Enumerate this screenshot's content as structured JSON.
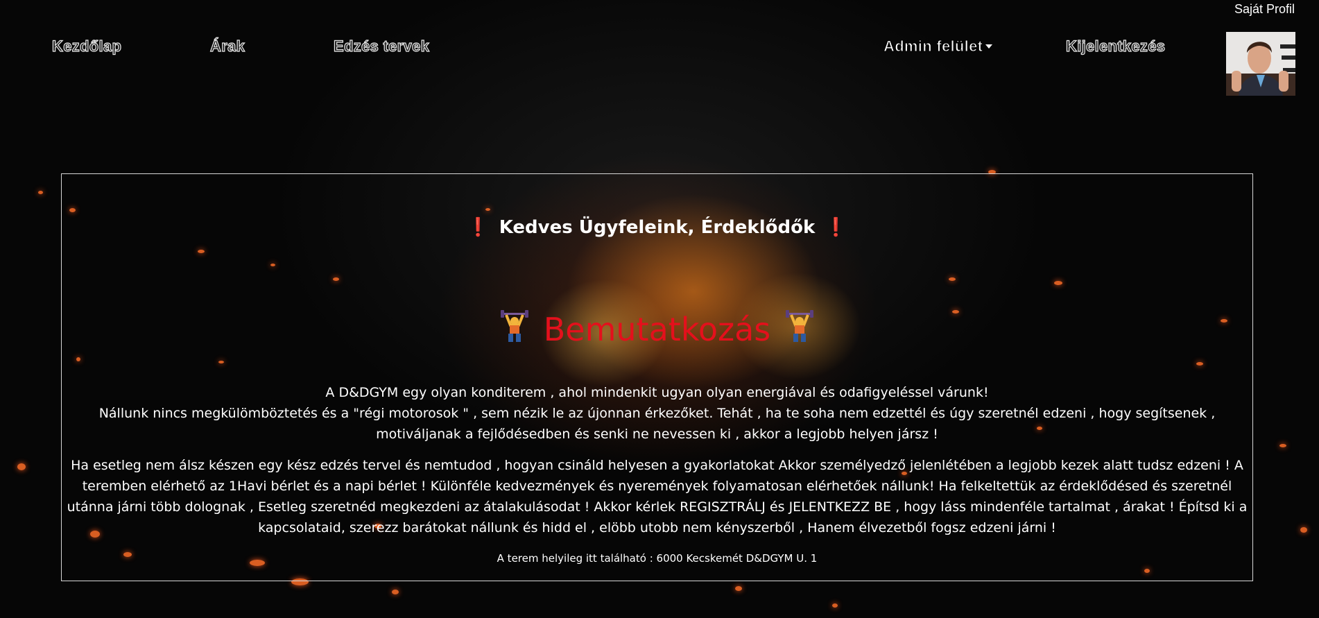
{
  "header": {
    "profile_link": "Saját Profil",
    "nav": {
      "home": "Kezdőlap",
      "prices": "Árak",
      "plans": "Edzés tervek",
      "admin": "Admin felület",
      "logout": "Kijelentkezés"
    }
  },
  "content": {
    "greeting": "Kedves Ügyfeleink, Érdeklődők",
    "greeting_icon": "exclamation-mark-icon",
    "intro_title": "Bemutatkozás",
    "intro_icon": "weightlifter-icon",
    "paragraph1_line1": "A D&DGYM egy olyan konditerem , ahol mindenkit ugyan olyan energiával és odafigyeléssel várunk!",
    "paragraph1_line2": "Nállunk nincs megkülömböztetés és a \"régi motorosok \" , sem nézik le az újonnan érkezőket. Tehát , ha te soha nem edzettél és úgy szeretnél edzeni , hogy segítsenek , motiváljanak a fejlődésedben és senki ne nevessen ki , akkor a legjobb helyen jársz !",
    "paragraph2": "Ha esetleg nem álsz készen egy kész edzés tervel és nemtudod , hogyan csináld helyesen a gyakorlatokat Akkor személyedző jelenlétében a legjobb kezek alatt tudsz edzeni ! A teremben elérhető az 1Havi bérlet és a napi bérlet ! Különféle kedvezmények és nyeremények folyamatosan elérhetőek nállunk! Ha felkeltettük az érdeklődésed és szeretnél utánna járni több dolognak , Esetleg szeretnéd megkezdeni az átalakulásodat ! Akkor kérlek REGISZTRÁLJ és JELENTKEZZ BE , hogy láss mindenféle tartalmat , árakat ! Építsd ki a kapcsolataid, szerezz barátokat nállunk és hidd el , elöbb utobb nem kényszerből , Hanem élvezetből fogsz edzeni járni !",
    "address": "A terem helyileg itt található : 6000 Kecskemét D&DGYM U. 1"
  },
  "colors": {
    "accent_red": "#e4101c",
    "exclamation_red": "#e01010",
    "background": "#060606",
    "fire_orange": "#ff8c1e"
  }
}
